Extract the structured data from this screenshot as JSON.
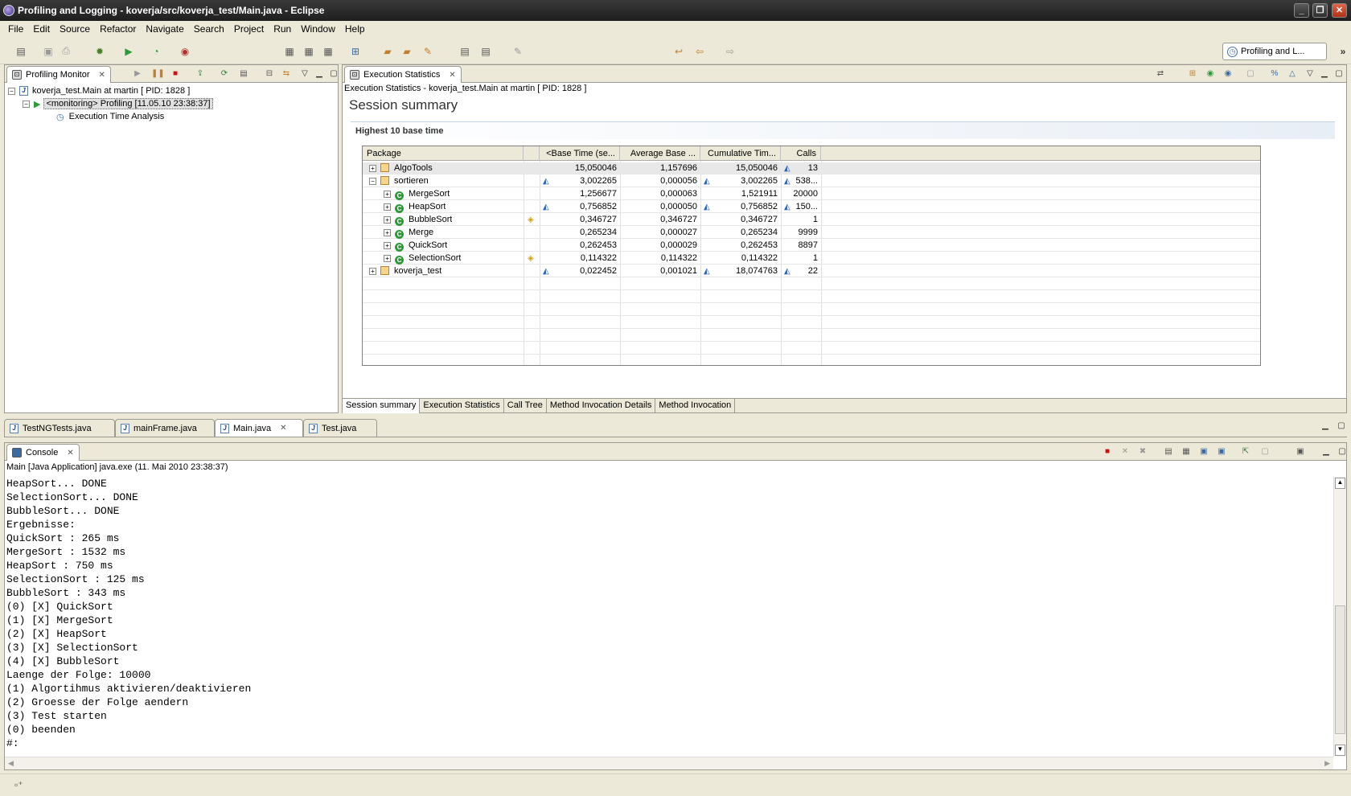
{
  "window": {
    "title": "Profiling and Logging - koverja/src/koverja_test/Main.java - Eclipse"
  },
  "menu": [
    "File",
    "Edit",
    "Source",
    "Refactor",
    "Navigate",
    "Search",
    "Project",
    "Run",
    "Window",
    "Help"
  ],
  "perspective": {
    "label": "Profiling and L..."
  },
  "profiling_monitor": {
    "tab": "Profiling Monitor",
    "tree": [
      {
        "label": "koverja_test.Main at martin [ PID: 1828 ]"
      },
      {
        "label": "<monitoring> Profiling [11.05.10 23:38:37]"
      },
      {
        "label": "Execution Time Analysis"
      }
    ]
  },
  "exec_stats": {
    "tab": "Execution Statistics",
    "breadcrumb": "Execution Statistics - koverja_test.Main at martin [ PID: 1828 ]",
    "title": "Session summary",
    "section": "Highest 10 base time",
    "columns": [
      "Package",
      "<Base Time (se...",
      "Average Base ...",
      "Cumulative Tim...",
      "Calls"
    ],
    "rows": [
      {
        "name": "AlgoTools",
        "base": "15,050046",
        "avg": "1,157696",
        "cum": "15,050046",
        "calls": "13"
      },
      {
        "name": "sortieren",
        "base": "3,002265",
        "avg": "0,000056",
        "cum": "3,002265",
        "calls": "538..."
      },
      {
        "name": "MergeSort",
        "base": "1,256677",
        "avg": "0,000063",
        "cum": "1,521911",
        "calls": "20000"
      },
      {
        "name": "HeapSort",
        "base": "0,756852",
        "avg": "0,000050",
        "cum": "0,756852",
        "calls": "150..."
      },
      {
        "name": "BubbleSort",
        "base": "0,346727",
        "avg": "0,346727",
        "cum": "0,346727",
        "calls": "1"
      },
      {
        "name": "Merge",
        "base": "0,265234",
        "avg": "0,000027",
        "cum": "0,265234",
        "calls": "9999"
      },
      {
        "name": "QuickSort",
        "base": "0,262453",
        "avg": "0,000029",
        "cum": "0,262453",
        "calls": "8897"
      },
      {
        "name": "SelectionSort",
        "base": "0,114322",
        "avg": "0,114322",
        "cum": "0,114322",
        "calls": "1"
      },
      {
        "name": "koverja_test",
        "base": "0,022452",
        "avg": "0,001021",
        "cum": "18,074763",
        "calls": "22"
      }
    ],
    "bottom_tabs": [
      "Session summary",
      "Execution Statistics",
      "Call Tree",
      "Method Invocation Details",
      "Method Invocation"
    ]
  },
  "editor_tabs": [
    "TestNGTests.java",
    "mainFrame.java",
    "Main.java",
    "Test.java"
  ],
  "console": {
    "tab": "Console",
    "header": "Main [Java Application] java.exe (11. Mai 2010 23:38:37)",
    "lines": [
      "HeapSort... DONE",
      "SelectionSort... DONE",
      "BubbleSort... DONE",
      "Ergebnisse:",
      "QuickSort : 265 ms",
      "MergeSort : 1532 ms",
      "HeapSort : 750 ms",
      "SelectionSort : 125 ms",
      "BubbleSort : 343 ms",
      "(0) [X] QuickSort",
      "(1) [X] MergeSort",
      "(2) [X] HeapSort",
      "(3) [X] SelectionSort",
      "(4) [X] BubbleSort",
      "Laenge der Folge: 10000",
      "(1) Algortihmus aktivieren/deaktivieren",
      "(2) Groesse der Folge aendern",
      "(3) Test starten",
      "(0) beenden",
      "#:"
    ]
  }
}
